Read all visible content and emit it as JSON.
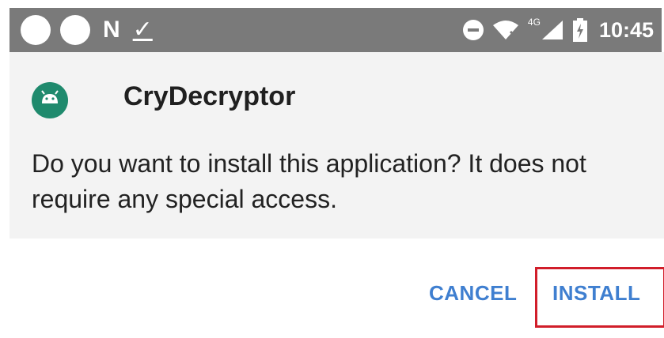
{
  "status_bar": {
    "icons": [
      "circle-notification-icon",
      "circle-notification-icon",
      "n-icon",
      "download-check-icon",
      "dnd-icon",
      "wifi-icon",
      "signal-icon",
      "battery-icon"
    ],
    "lte_label": "4G",
    "time": "10:45"
  },
  "dialog": {
    "app_name": "CryDecryptor",
    "message": "Do you want to install this application? It does not require any special access.",
    "buttons": {
      "cancel": "CANCEL",
      "install": "INSTALL"
    },
    "accent_color": "#3f7fd0",
    "highlight_color": "#d11e2a",
    "app_icon_color": "#1f8a6d"
  }
}
